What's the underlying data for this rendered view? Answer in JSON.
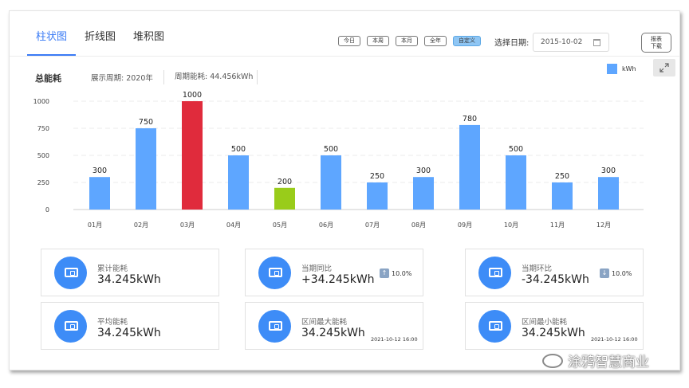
{
  "tabs": [
    {
      "label": "柱状图",
      "active": true
    },
    {
      "label": "折线图",
      "active": false
    },
    {
      "label": "堆积图",
      "active": false
    }
  ],
  "periods": [
    {
      "label": "今日",
      "active": false
    },
    {
      "label": "本周",
      "active": false
    },
    {
      "label": "本月",
      "active": false
    },
    {
      "label": "全年",
      "active": false
    },
    {
      "label": "自定义",
      "active": true
    }
  ],
  "date": {
    "label": "选择日期:",
    "value": "2015-10-02",
    "icon": "calendar-icon"
  },
  "report_button": {
    "line1": "报表",
    "line2": "下载"
  },
  "chart_header": {
    "title": "总能耗",
    "period_info": "展示周期: 2020年",
    "energy_info": "周期能耗: 44.456kWh",
    "legend": "kWh",
    "expand_icon": "expand-icon"
  },
  "colors": {
    "accent": "#3a7bf5",
    "bar": "#5ea6ff",
    "max_bar": "#e02b3c",
    "min_bar": "#99cc1a",
    "icon_bg": "#3d8cf7"
  },
  "chart_data": {
    "type": "bar",
    "categories": [
      "01月",
      "02月",
      "03月",
      "04月",
      "05月",
      "06月",
      "07月",
      "08月",
      "09月",
      "10月",
      "11月",
      "12月"
    ],
    "values": [
      300,
      750,
      1000,
      500,
      200,
      500,
      250,
      300,
      780,
      500,
      250,
      300
    ],
    "highlight": {
      "max_index": 2,
      "min_index": 4
    },
    "y_ticks": [
      "0",
      "250",
      "500",
      "750",
      "1000"
    ],
    "ylim": [
      0,
      1000
    ],
    "legend": [
      "kWh"
    ],
    "grid": true
  },
  "cards": [
    {
      "label": "累计能耗",
      "value": "34.245kWh",
      "delta": "",
      "arrow": "",
      "timestamp": ""
    },
    {
      "label": "当期同比",
      "value": "+34.245kWh",
      "delta": "10.0%",
      "arrow": "up",
      "timestamp": ""
    },
    {
      "label": "当期环比",
      "value": "-34.245kWh",
      "delta": "10.0%",
      "arrow": "down",
      "timestamp": ""
    },
    {
      "label": "平均能耗",
      "value": "34.245kWh",
      "delta": "",
      "arrow": "",
      "timestamp": ""
    },
    {
      "label": "区间最大能耗",
      "value": "34.245kWh",
      "delta": "",
      "arrow": "",
      "timestamp": "2021-10-12 16:00"
    },
    {
      "label": "区间最小能耗",
      "value": "34.245kWh",
      "delta": "",
      "arrow": "",
      "timestamp": "2021-10-12 16:00"
    }
  ],
  "watermark": "涂鸦智慧商业"
}
